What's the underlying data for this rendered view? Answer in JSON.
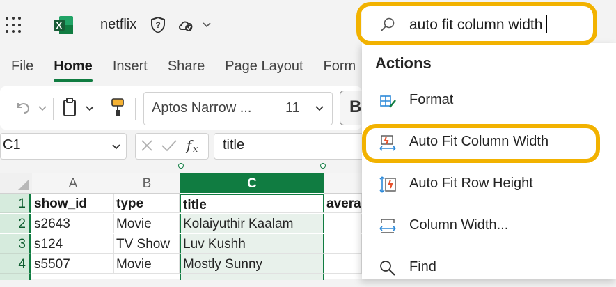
{
  "titlebar": {
    "filename": "netflix"
  },
  "ribbon": {
    "tabs": [
      "File",
      "Home",
      "Insert",
      "Share",
      "Page Layout",
      "Form"
    ],
    "active_tab": "Home"
  },
  "toolbar": {
    "font_name": "Aptos Narrow ...",
    "font_size": "11",
    "bold_label": "B"
  },
  "formula_bar": {
    "cell_ref": "C1",
    "formula": "title"
  },
  "grid": {
    "columns": [
      "A",
      "B",
      "C"
    ],
    "selected_column": "C",
    "rows": [
      {
        "num": "1",
        "cells": [
          "show_id",
          "type",
          "title",
          "averag"
        ]
      },
      {
        "num": "2",
        "cells": [
          "s2643",
          "Movie",
          "Kolaiyuthir Kaalam",
          ""
        ]
      },
      {
        "num": "3",
        "cells": [
          "s124",
          "TV Show",
          "Luv Kushh",
          ""
        ]
      },
      {
        "num": "4",
        "cells": [
          "s5507",
          "Movie",
          "Mostly Sunny",
          ""
        ]
      }
    ]
  },
  "search": {
    "query": "auto fit column width",
    "section_title": "Actions",
    "actions": [
      {
        "label": "Format",
        "icon": "format-icon"
      },
      {
        "label": "Auto Fit Column Width",
        "icon": "autofit-column-icon",
        "highlighted": true
      },
      {
        "label": "Auto Fit Row Height",
        "icon": "autofit-row-icon"
      },
      {
        "label": "Column Width...",
        "icon": "column-width-icon"
      },
      {
        "label": "Find",
        "icon": "search-icon"
      }
    ]
  },
  "colors": {
    "excel_green": "#107c41",
    "highlight": "#f2b200",
    "accent_red": "#e8512b"
  }
}
